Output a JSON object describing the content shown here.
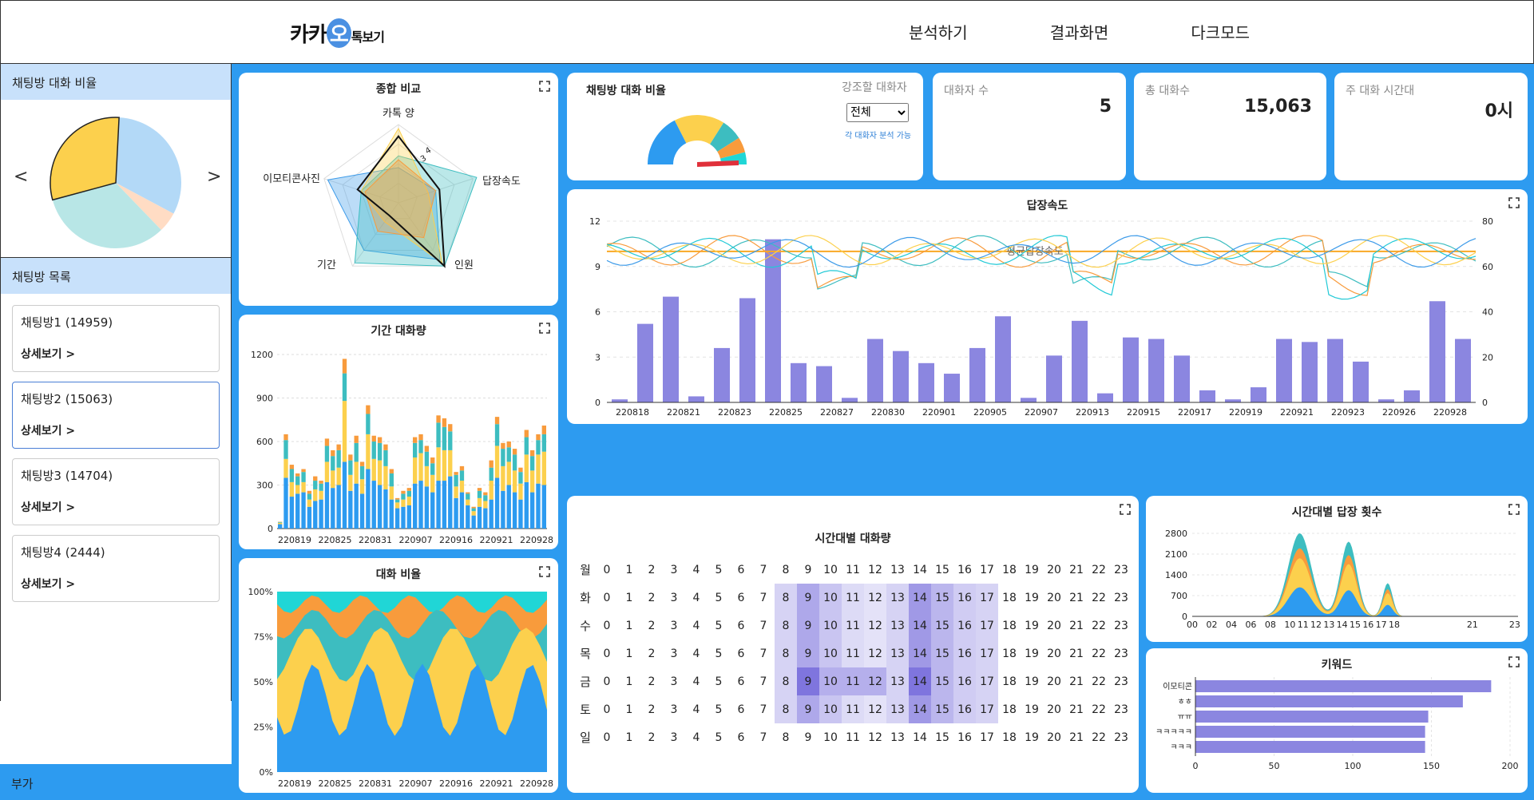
{
  "header": {
    "logo_text_a": "카카",
    "logo_text_o": "오",
    "logo_text_b": "톡보기",
    "nav": [
      "분석하기",
      "결과화면",
      "다크모드"
    ]
  },
  "sidebar": {
    "ratio_title": "채팅방 대화 비율",
    "list_title": "채팅방 목록",
    "footer": "부가",
    "prev": "<",
    "next": ">",
    "chats": [
      {
        "name": "채팅방1 (14959)",
        "detail": "상세보기 >"
      },
      {
        "name": "채팅방2 (15063)",
        "detail": "상세보기 >"
      },
      {
        "name": "채팅방3 (14704)",
        "detail": "상세보기 >"
      },
      {
        "name": "채팅방4 (2444)",
        "detail": "상세보기 >"
      }
    ]
  },
  "cards": {
    "radar_title": "종합 비교",
    "volume_title": "기간 대화량",
    "ratio_title": "대화 비율",
    "gauge_title": "채팅방 대화 비율",
    "emphasis_label": "강조할 대화자",
    "emphasis_value": "전체",
    "emphasis_hint": "각 대화자 분석 가능",
    "reply_title": "답장속도",
    "heat_title": "시간대별 대화량",
    "hourly_title": "시간대별 답장 횟수",
    "keyword_title": "키워드"
  },
  "stats": [
    {
      "label": "대화자 수",
      "value": "5"
    },
    {
      "label": "총 대화수",
      "value": "15,063"
    },
    {
      "label": "주 대화 시간대",
      "value": "0시"
    }
  ],
  "colors": {
    "blue": "#2d9bf0",
    "yellow": "#fcd04d",
    "teal": "#3dbdc0",
    "orange": "#f89b3c",
    "cyan": "#20d6d6",
    "purple": "#8b86e0"
  },
  "chart_data": [
    {
      "type": "pie",
      "title": "채팅방 대화 비율",
      "values": [
        32,
        5,
        33,
        30
      ],
      "colors": [
        "#b3d9f7",
        "#ffdcc4",
        "#b8e6e6",
        "#fcd04d"
      ]
    },
    {
      "type": "radar",
      "title": "종합 비교",
      "axes": [
        "카톡 양",
        "답장속도",
        "인원",
        "기간",
        "이모티콘사진"
      ],
      "ticks": [
        "3",
        "4"
      ]
    },
    {
      "type": "bar",
      "title": "기간 대화량",
      "stacked": true,
      "yticks": [
        0,
        300,
        600,
        900,
        1200
      ],
      "xticks": [
        "220819",
        "220825",
        "220831",
        "220907",
        "220916",
        "220921",
        "220928"
      ],
      "series": [
        {
          "values": [
            30,
            350,
            220,
            240,
            250,
            150,
            190,
            200,
            320,
            280,
            300,
            460,
            260,
            310,
            240,
            410,
            330,
            300,
            270,
            200,
            140,
            150,
            160,
            310,
            330,
            290,
            250,
            330,
            330,
            360,
            210,
            250,
            160,
            90,
            150,
            140,
            200,
            350,
            260,
            300,
            250,
            200,
            320,
            250,
            310,
            300
          ]
        },
        {
          "values": [
            10,
            130,
            100,
            60,
            70,
            50,
            80,
            60,
            140,
            120,
            120,
            420,
            110,
            150,
            100,
            240,
            150,
            170,
            160,
            90,
            40,
            50,
            60,
            180,
            190,
            140,
            120,
            230,
            210,
            180,
            80,
            80,
            40,
            30,
            60,
            50,
            130,
            220,
            170,
            160,
            150,
            110,
            190,
            150,
            200,
            230
          ]
        },
        {
          "values": [
            5,
            130,
            90,
            60,
            70,
            40,
            60,
            50,
            110,
            100,
            120,
            190,
            100,
            130,
            90,
            140,
            120,
            120,
            110,
            90,
            20,
            40,
            40,
            100,
            90,
            100,
            80,
            170,
            160,
            130,
            80,
            70,
            40,
            20,
            50,
            40,
            90,
            150,
            120,
            100,
            110,
            80,
            120,
            100,
            100,
            120
          ]
        },
        {
          "values": [
            2,
            40,
            30,
            20,
            20,
            20,
            30,
            20,
            50,
            40,
            40,
            100,
            40,
            50,
            30,
            60,
            40,
            40,
            40,
            30,
            10,
            20,
            20,
            40,
            40,
            40,
            40,
            50,
            60,
            50,
            20,
            30,
            10,
            10,
            20,
            20,
            50,
            50,
            40,
            40,
            40,
            30,
            50,
            40,
            40,
            60
          ]
        }
      ]
    },
    {
      "type": "area",
      "title": "대화 비율",
      "yticks": [
        "0%",
        "25%",
        "50%",
        "75%",
        "100%"
      ],
      "xticks": [
        "220819",
        "220825",
        "220831",
        "220907",
        "220916",
        "220921",
        "220928"
      ]
    },
    {
      "type": "bar",
      "title": "답장속도",
      "categories": [
        "220818",
        "220821",
        "220823",
        "220825",
        "220827",
        "220830",
        "220901",
        "220905",
        "220907",
        "220913",
        "220915",
        "220917",
        "220919",
        "220921",
        "220923",
        "220926",
        "220928"
      ],
      "values": [
        0.2,
        5.2,
        7.0,
        0.4,
        3.6,
        6.9,
        10.8,
        2.6,
        2.4,
        0.3,
        4.2,
        3.4,
        2.6,
        1.9,
        3.6,
        5.7,
        0.3,
        3.1,
        5.4,
        0.6,
        4.3,
        4.2,
        3.1,
        0.8,
        0.2,
        1.0,
        4.2,
        4.0,
        4.2,
        2.7,
        0.2,
        0.8,
        6.7,
        4.2
      ],
      "yticks_left": [
        0,
        3,
        6,
        9,
        12
      ],
      "yticks_right": [
        0,
        20,
        40,
        60,
        80
      ],
      "annotation": "평균답장속도"
    },
    {
      "type": "heatmap",
      "title": "시간대별 대화량",
      "rows": [
        "월",
        "화",
        "수",
        "목",
        "금",
        "토",
        "일"
      ],
      "cols": [
        "0",
        "1",
        "2",
        "3",
        "4",
        "5",
        "6",
        "7",
        "8",
        "9",
        "10",
        "11",
        "12",
        "13",
        "14",
        "15",
        "16",
        "17",
        "18",
        "19",
        "20",
        "21",
        "22",
        "23"
      ]
    },
    {
      "type": "area",
      "title": "시간대별 답장 횟수",
      "yticks": [
        0,
        700,
        1400,
        2100,
        2800
      ],
      "xticks": [
        "00",
        "02",
        "04",
        "06",
        "08",
        "10",
        "11",
        "12",
        "13",
        "14",
        "15",
        "16",
        "17",
        "18",
        "21",
        "23"
      ]
    },
    {
      "type": "bar",
      "title": "키워드",
      "categories": [
        "이모티콘",
        "ㅎㅎ",
        "ㅠㅠ",
        "ㅋㅋㅋㅋㅋ",
        "ㅋㅋㅋ"
      ],
      "values": [
        188,
        170,
        148,
        146,
        146
      ],
      "xticks": [
        0,
        50,
        100,
        150,
        200
      ]
    }
  ]
}
